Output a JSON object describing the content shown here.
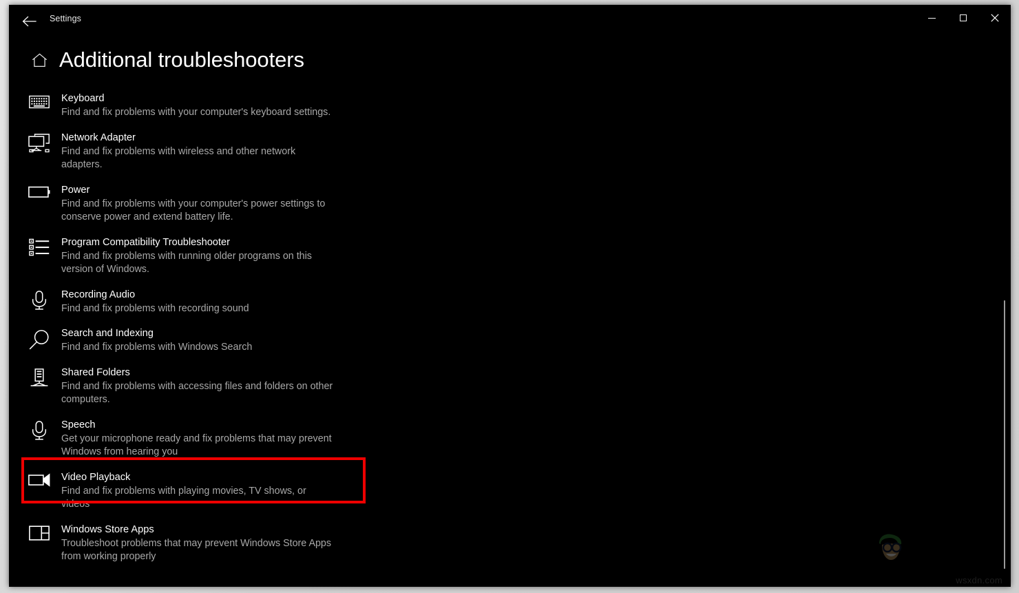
{
  "window": {
    "app_title": "Settings",
    "back_icon": "back-arrow-icon",
    "minimize_label": "Minimize",
    "maximize_label": "Maximize",
    "close_label": "Close"
  },
  "page": {
    "home_icon": "home-icon",
    "title": "Additional troubleshooters"
  },
  "highlight": {
    "color": "#ee0000",
    "target": "Video Playback"
  },
  "troubleshooters": [
    {
      "icon": "keyboard-icon",
      "name": "Keyboard",
      "description": "Find and fix problems with your computer's keyboard settings."
    },
    {
      "icon": "network-adapter-icon",
      "name": "Network Adapter",
      "description": "Find and fix problems with wireless and other network adapters."
    },
    {
      "icon": "battery-icon",
      "name": "Power",
      "description": "Find and fix problems with your computer's power settings to conserve power and extend battery life."
    },
    {
      "icon": "list-icon",
      "name": "Program Compatibility Troubleshooter",
      "description": "Find and fix problems with running older programs on this version of Windows."
    },
    {
      "icon": "microphone-icon",
      "name": "Recording Audio",
      "description": "Find and fix problems with recording sound"
    },
    {
      "icon": "magnifier-icon",
      "name": "Search and Indexing",
      "description": "Find and fix problems with Windows Search"
    },
    {
      "icon": "server-share-icon",
      "name": "Shared Folders",
      "description": "Find and fix problems with accessing files and folders on other computers."
    },
    {
      "icon": "microphone-icon",
      "name": "Speech",
      "description": "Get your microphone ready and fix problems that may prevent Windows from hearing you"
    },
    {
      "icon": "video-camera-icon",
      "name": "Video Playback",
      "description": "Find and fix problems with playing movies, TV shows, or videos"
    },
    {
      "icon": "store-apps-icon",
      "name": "Windows Store Apps",
      "description": "Troubleshoot problems that may prevent Windows Store Apps from working properly"
    }
  ],
  "watermark": {
    "text": "wsxdn.com"
  }
}
